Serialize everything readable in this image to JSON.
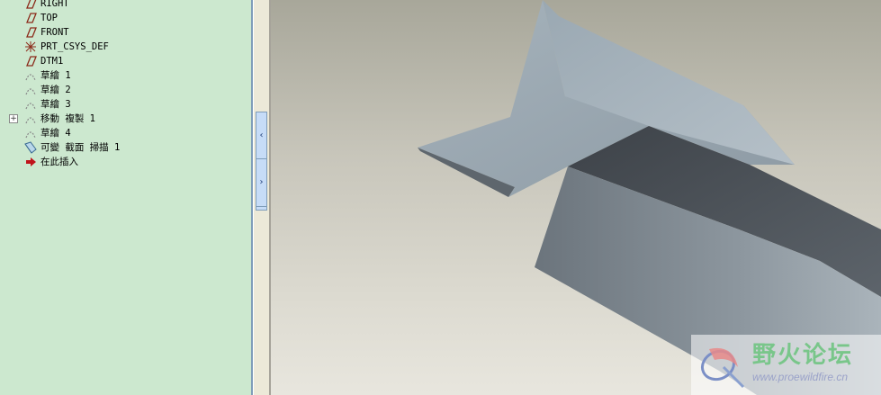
{
  "model_tree": {
    "items": [
      {
        "label": "RIGHT",
        "icon": "datum-plane-icon"
      },
      {
        "label": "TOP",
        "icon": "datum-plane-icon"
      },
      {
        "label": "FRONT",
        "icon": "datum-plane-icon"
      },
      {
        "label": "PRT_CSYS_DEF",
        "icon": "coordinate-system-icon"
      },
      {
        "label": "DTM1",
        "icon": "datum-plane-icon"
      },
      {
        "label": "草繪 1",
        "icon": "sketch-icon"
      },
      {
        "label": "草繪 2",
        "icon": "sketch-icon"
      },
      {
        "label": "草繪 3",
        "icon": "sketch-icon"
      },
      {
        "label": "移動 複製 1",
        "icon": "sketch-icon",
        "expander": "+"
      },
      {
        "label": "草繪 4",
        "icon": "sketch-icon"
      },
      {
        "label": "可變 截面 掃描 1",
        "icon": "variable-sweep-icon"
      },
      {
        "label": "在此插入",
        "icon": "insert-here-arrow-icon"
      }
    ]
  },
  "sash": {
    "collapse_glyph": "‹",
    "expand_glyph": "›"
  },
  "watermark": {
    "title": "野火论坛",
    "url": "www.proewildfire.cn"
  },
  "colors": {
    "tree_background": "#cce8cf",
    "model_surface": "#9daab4",
    "model_dark_face": "#4a4f55",
    "accent": "#7f9db9"
  }
}
